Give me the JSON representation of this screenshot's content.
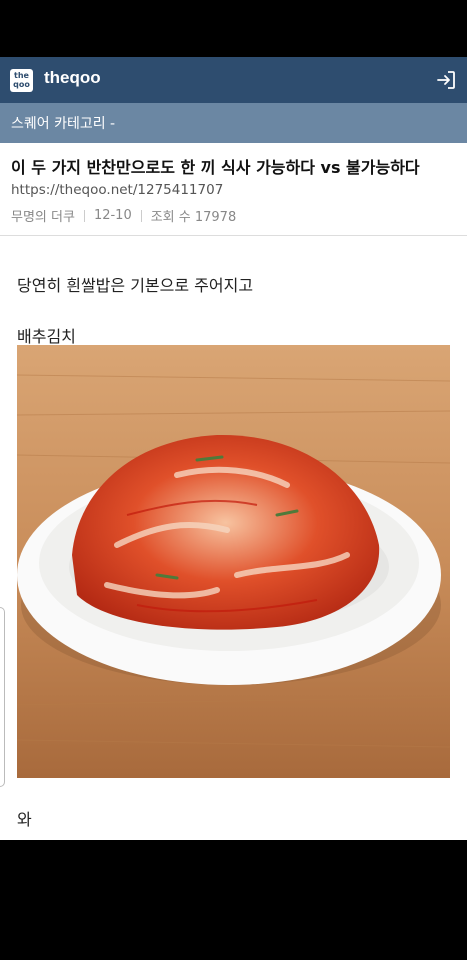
{
  "app": {
    "logo_text": "the qoo",
    "brand": "theqoo",
    "category": "스퀘어 카테고리 -"
  },
  "post": {
    "title": "이 두 가지 반찬만으로도 한 끼 식사 가능하다 vs 불가능하다",
    "url": "https://theqoo.net/1275411707",
    "author": "무명의 더쿠",
    "date": "12-10",
    "views": "조회 수 17978",
    "paragraph1": "당연히 흰쌀밥은 기본으로 주어지고",
    "paragraph2": "배추김치",
    "paragraph3": "와"
  },
  "colors": {
    "appbar": "#2e4d6f",
    "catbar": "#6b87a3"
  },
  "icons": {
    "login": "login-arrow-icon",
    "logo": "theqoo-logo-icon"
  }
}
